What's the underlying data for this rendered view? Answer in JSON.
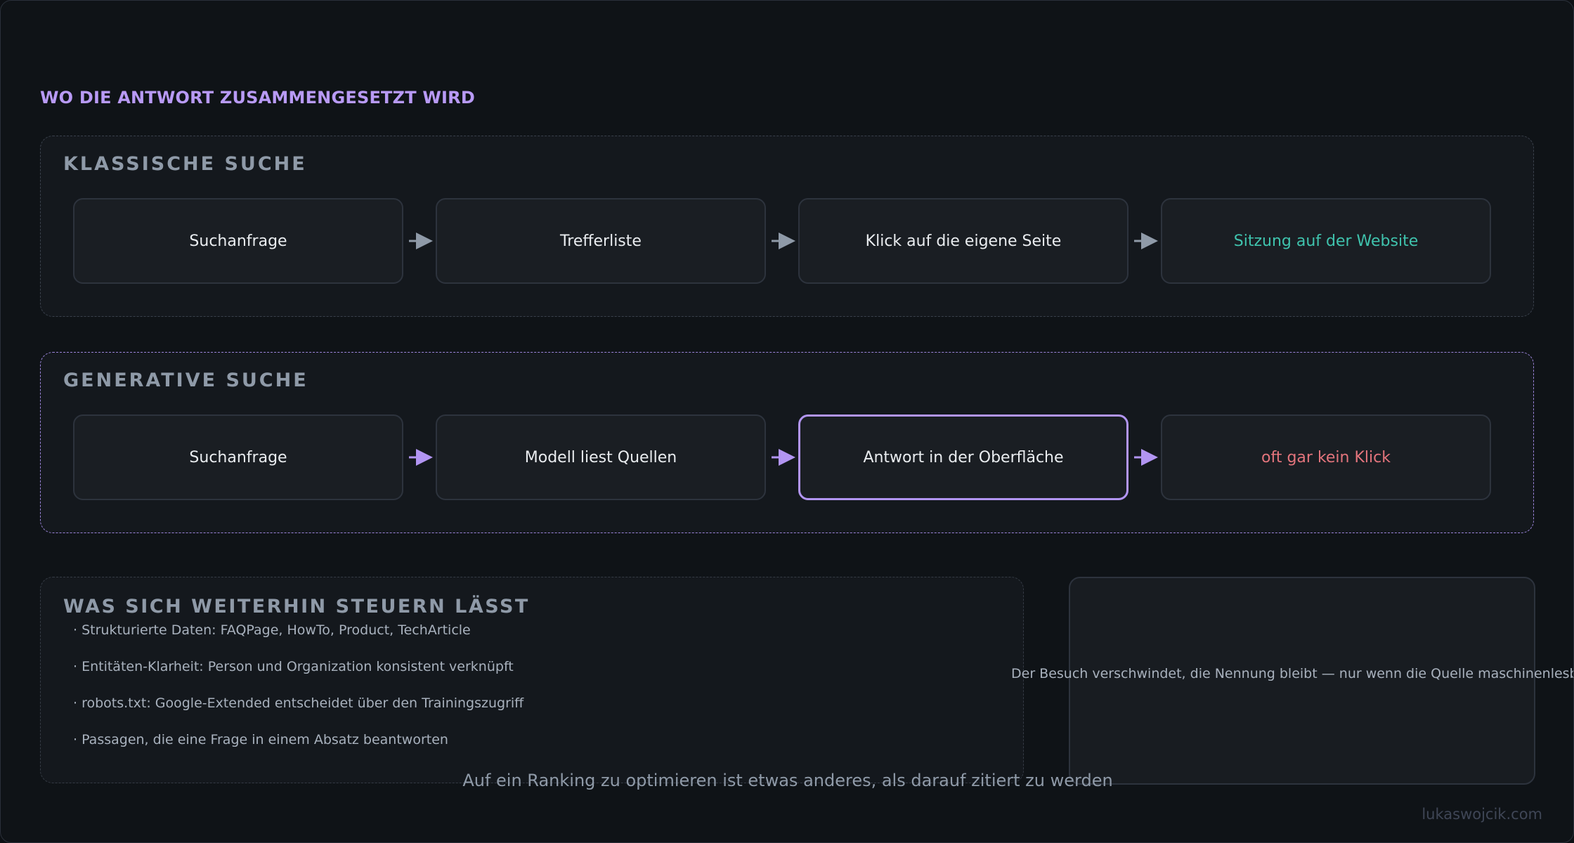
{
  "heading": "WO DIE ANTWORT ZUSAMMENGESETZT WIRD",
  "classic": {
    "title": "KLASSISCHE SUCHE",
    "steps": [
      "Suchanfrage",
      "Trefferliste",
      "Klick auf die eigene Seite",
      "Sitzung auf der Website"
    ]
  },
  "generative": {
    "title": "GENERATIVE SUCHE",
    "steps": [
      "Suchanfrage",
      "Modell liest Quellen",
      "Antwort in der Oberfläche",
      "oft gar kein Klick"
    ]
  },
  "control": {
    "title": "WAS SICH WEITERHIN STEUERN LÄSST",
    "items": [
      "· Strukturierte Daten: FAQPage, HowTo, Product, TechArticle",
      "· Entitäten-Klarheit: Person und Organization konsistent verknüpft",
      "· robots.txt: Google-Extended entscheidet über den Trainingszugriff",
      "· Passagen, die eine Frage in einem Absatz beantworten"
    ]
  },
  "note": "Der Besuch verschwindet, die Nennung bleibt — nur wenn die Quelle maschinenlesbar ist",
  "footer": "Auf ein Ranking zu optimieren ist etwas anderes, als darauf zitiert zu werden",
  "credit": "lukaswojcik.com",
  "colors": {
    "accent": "#b295f2",
    "positive": "#3fc3ad",
    "negative": "#e3747c",
    "arrow_classic": "#8f9aa8",
    "arrow_generative": "#b295f2"
  }
}
